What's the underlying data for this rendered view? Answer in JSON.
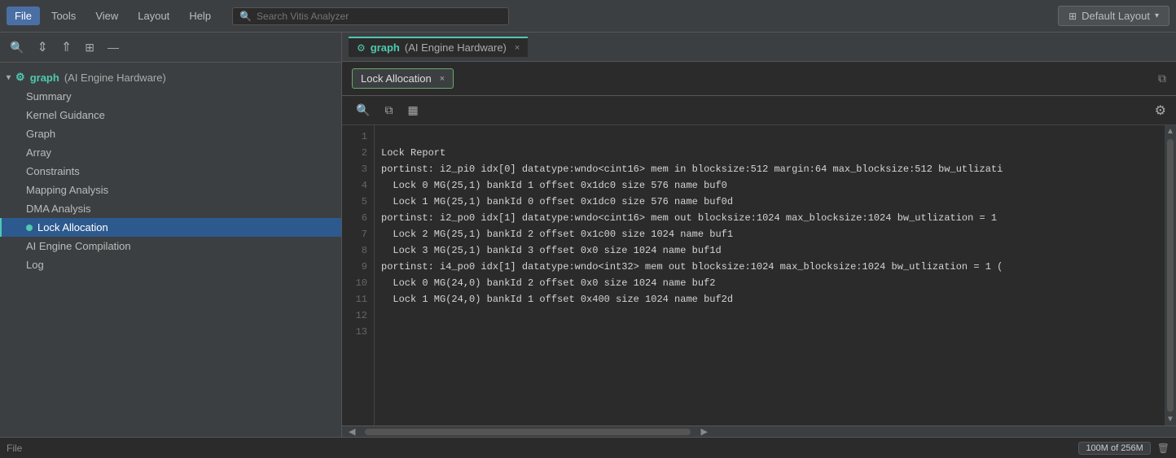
{
  "menubar": {
    "file_label": "File",
    "tools_label": "Tools",
    "view_label": "View",
    "layout_label": "Layout",
    "help_label": "Help",
    "search_placeholder": "Search Vitis Analyzer",
    "layout_button": "Default Layout"
  },
  "sidebar": {
    "toolbar_collapse_tooltip": "Collapse",
    "toolbar_expand_tooltip": "Expand",
    "toolbar_link_tooltip": "Link",
    "toolbar_minus_tooltip": "Minimize",
    "root_label": "graph (AI Engine Hardware)",
    "items": [
      {
        "id": "summary",
        "label": "Summary",
        "active": false
      },
      {
        "id": "kernel-guidance",
        "label": "Kernel Guidance",
        "active": false
      },
      {
        "id": "graph",
        "label": "Graph",
        "active": false
      },
      {
        "id": "array",
        "label": "Array",
        "active": false
      },
      {
        "id": "constraints",
        "label": "Constraints",
        "active": false
      },
      {
        "id": "mapping-analysis",
        "label": "Mapping Analysis",
        "active": false
      },
      {
        "id": "dma-analysis",
        "label": "DMA Analysis",
        "active": false
      },
      {
        "id": "lock-allocation",
        "label": "Lock Allocation",
        "active": true
      },
      {
        "id": "ai-engine-compilation",
        "label": "AI Engine Compilation",
        "active": false
      },
      {
        "id": "log",
        "label": "Log",
        "active": false
      }
    ]
  },
  "editor": {
    "tab_label": "graph (AI Engine Hardware)",
    "tab_close": "×"
  },
  "lock_allocation": {
    "panel_title": "Lock Allocation",
    "panel_close": "×",
    "code_lines": [
      {
        "num": 1,
        "text": ""
      },
      {
        "num": 2,
        "text": "Lock Report"
      },
      {
        "num": 3,
        "text": "portinst: i2_pi0 idx[0] datatype:wndo<cint16> mem in blocksize:512 margin:64 max_blocksize:512 bw_utlizati"
      },
      {
        "num": 4,
        "text": "  Lock 0 MG(25,1) bankId 1 offset 0x1dc0 size 576 name buf0"
      },
      {
        "num": 5,
        "text": "  Lock 1 MG(25,1) bankId 0 offset 0x1dc0 size 576 name buf0d"
      },
      {
        "num": 6,
        "text": "portinst: i2_po0 idx[1] datatype:wndo<cint16> mem out blocksize:1024 max_blocksize:1024 bw_utlization = 1"
      },
      {
        "num": 7,
        "text": "  Lock 2 MG(25,1) bankId 2 offset 0x1c00 size 1024 name buf1"
      },
      {
        "num": 8,
        "text": "  Lock 3 MG(25,1) bankId 3 offset 0x0 size 1024 name buf1d"
      },
      {
        "num": 9,
        "text": "portinst: i4_po0 idx[1] datatype:wndo<int32> mem out blocksize:1024 max_blocksize:1024 bw_utlization = 1 ("
      },
      {
        "num": 10,
        "text": "  Lock 0 MG(24,0) bankId 2 offset 0x0 size 1024 name buf2"
      },
      {
        "num": 11,
        "text": "  Lock 1 MG(24,0) bankId 1 offset 0x400 size 1024 name buf2d"
      },
      {
        "num": 12,
        "text": ""
      },
      {
        "num": 13,
        "text": ""
      }
    ]
  },
  "statusbar": {
    "file_label": "File",
    "memory_usage": "100M of 256M"
  }
}
